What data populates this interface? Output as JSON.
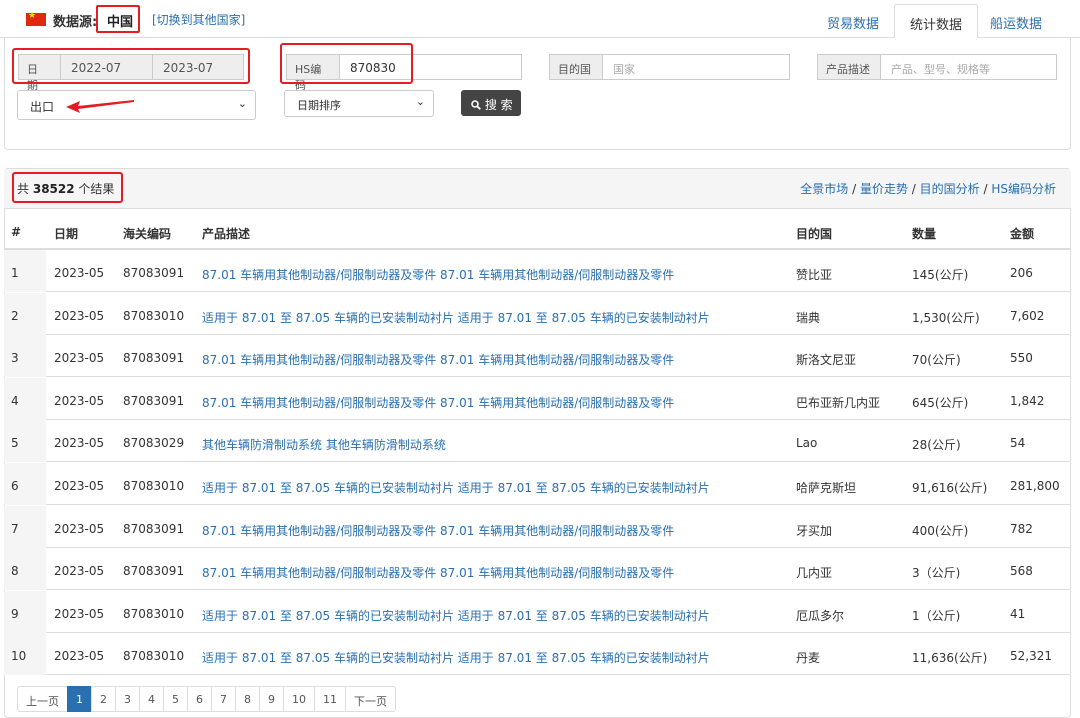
{
  "header": {
    "source_label": "数据源:",
    "country": "中国",
    "switch_link": "[切换到其他国家]",
    "tabs": [
      {
        "label": "贸易数据",
        "active": false
      },
      {
        "label": "统计数据",
        "active": true
      },
      {
        "label": "船运数据",
        "active": false
      }
    ]
  },
  "filters": {
    "date_label": "日 期",
    "date_from": "2022-07",
    "date_to": "2023-07",
    "hs_label": "HS编码",
    "hs_value": "870830",
    "dest_label": "目的国",
    "dest_placeholder": "国家",
    "desc_label": "产品描述",
    "desc_placeholder": "产品、型号、规格等",
    "direction": "出口",
    "sort": "日期排序",
    "search_button": "搜 索"
  },
  "results": {
    "count_prefix": "共",
    "count": "38522",
    "count_suffix": "个结果",
    "links": [
      "全景市场",
      "量价走势",
      "目的国分析",
      "HS编码分析"
    ],
    "link_separator": " / "
  },
  "table": {
    "headers": [
      "#",
      "日期",
      "海关编码",
      "产品描述",
      "目的国",
      "数量",
      "金额"
    ],
    "rows": [
      {
        "num": "1",
        "date": "2023-05",
        "code": "87083091",
        "desc": "87.01 车辆用其他制动器/伺服制动器及零件 87.01 车辆用其他制动器/伺服制动器及零件",
        "dest": "赞比亚",
        "qty": "145(公斤)",
        "amount": "206"
      },
      {
        "num": "2",
        "date": "2023-05",
        "code": "87083010",
        "desc": "适用于 87.01 至 87.05 车辆的已安装制动衬片 适用于 87.01 至 87.05 车辆的已安装制动衬片",
        "dest": "瑞典",
        "qty": "1,530(公斤)",
        "amount": "7,602"
      },
      {
        "num": "3",
        "date": "2023-05",
        "code": "87083091",
        "desc": "87.01 车辆用其他制动器/伺服制动器及零件 87.01 车辆用其他制动器/伺服制动器及零件",
        "dest": "斯洛文尼亚",
        "qty": "70(公斤)",
        "amount": "550"
      },
      {
        "num": "4",
        "date": "2023-05",
        "code": "87083091",
        "desc": "87.01 车辆用其他制动器/伺服制动器及零件 87.01 车辆用其他制动器/伺服制动器及零件",
        "dest": "巴布亚新几内亚",
        "qty": "645(公斤)",
        "amount": "1,842"
      },
      {
        "num": "5",
        "date": "2023-05",
        "code": "87083029",
        "desc": "其他车辆防滑制动系统 其他车辆防滑制动系统",
        "dest": "Lao",
        "qty": "28(公斤)",
        "amount": "54"
      },
      {
        "num": "6",
        "date": "2023-05",
        "code": "87083010",
        "desc": "适用于 87.01 至 87.05 车辆的已安装制动衬片 适用于 87.01 至 87.05 车辆的已安装制动衬片",
        "dest": "哈萨克斯坦",
        "qty": "91,616(公斤)",
        "amount": "281,800"
      },
      {
        "num": "7",
        "date": "2023-05",
        "code": "87083091",
        "desc": "87.01 车辆用其他制动器/伺服制动器及零件 87.01 车辆用其他制动器/伺服制动器及零件",
        "dest": "牙买加",
        "qty": "400(公斤)",
        "amount": "782"
      },
      {
        "num": "8",
        "date": "2023-05",
        "code": "87083091",
        "desc": "87.01 车辆用其他制动器/伺服制动器及零件 87.01 车辆用其他制动器/伺服制动器及零件",
        "dest": "几内亚",
        "qty": "3（公斤)",
        "amount": "568"
      },
      {
        "num": "9",
        "date": "2023-05",
        "code": "87083010",
        "desc": "适用于 87.01 至 87.05 车辆的已安装制动衬片 适用于 87.01 至 87.05 车辆的已安装制动衬片",
        "dest": "厄瓜多尔",
        "qty": "1（公斤)",
        "amount": "41"
      },
      {
        "num": "10",
        "date": "2023-05",
        "code": "87083010",
        "desc": "适用于 87.01 至 87.05 车辆的已安装制动衬片 适用于 87.01 至 87.05 车辆的已安装制动衬片",
        "dest": "丹麦",
        "qty": "11,636(公斤)",
        "amount": "52,321"
      }
    ]
  },
  "pagination": {
    "prev": "上一页",
    "pages": [
      "1",
      "2",
      "3",
      "4",
      "5",
      "6",
      "7",
      "8",
      "9",
      "10",
      "11"
    ],
    "active_page": "1",
    "next": "下一页"
  },
  "icons": {
    "flag": "china-flag-icon",
    "search": "search-icon",
    "dropdown": "chevron-down-icon"
  },
  "colors": {
    "link": "#2a6fb0",
    "highlight": "#e51c23",
    "active_page": "#2a6fb0",
    "button": "#444444"
  }
}
